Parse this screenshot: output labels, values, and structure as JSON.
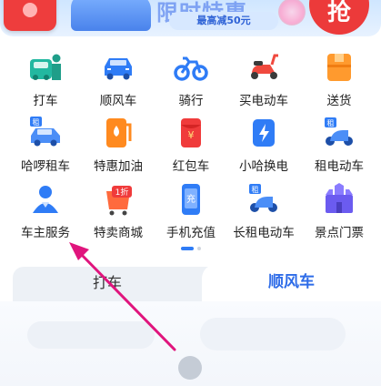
{
  "banner": {
    "headline": "限时特惠",
    "promo": "最高减50元",
    "go": "抢"
  },
  "services": [
    {
      "label": "打车",
      "icon": "taxi-driver-icon"
    },
    {
      "label": "顺风车",
      "icon": "hitch-car-icon"
    },
    {
      "label": "骑行",
      "icon": "bicycle-icon"
    },
    {
      "label": "买电动车",
      "icon": "electric-scooter-icon"
    },
    {
      "label": "送货",
      "icon": "delivery-box-icon"
    },
    {
      "label": "哈啰租车",
      "icon": "car-rental-icon"
    },
    {
      "label": "特惠加油",
      "icon": "fuel-pump-icon"
    },
    {
      "label": "红包车",
      "icon": "red-envelope-icon"
    },
    {
      "label": "小哈换电",
      "icon": "battery-swap-icon"
    },
    {
      "label": "租电动车",
      "icon": "rent-ebike-icon"
    },
    {
      "label": "车主服务",
      "icon": "car-owner-icon"
    },
    {
      "label": "特卖商城",
      "icon": "discount-mall-icon"
    },
    {
      "label": "手机充值",
      "icon": "phone-recharge-icon"
    },
    {
      "label": "长租电动车",
      "icon": "long-rent-ebike-icon"
    },
    {
      "label": "景点门票",
      "icon": "attraction-ticket-icon"
    }
  ],
  "services_extra": {
    "discount_badge": "1折",
    "recharge_char": "充",
    "rent_badge": "租",
    "yuan": "¥"
  },
  "tabs": {
    "dache": "打车",
    "shunfeng": "顺风车"
  },
  "pager": {
    "current": 1,
    "total": 2
  },
  "colors": {
    "accent": "#2f7cf6",
    "brand_red": "#ec3a3a",
    "arrow": "#e0157d"
  }
}
